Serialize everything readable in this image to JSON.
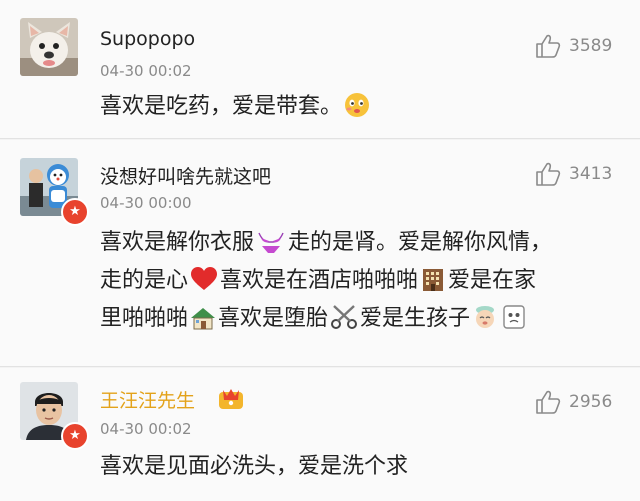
{
  "comments": [
    {
      "username": "Supopopo",
      "timestamp": "04-30 00:02",
      "likes": "3589",
      "text": "喜欢是吃药，爱是带套。",
      "avatar_icon": "bulldog-photo",
      "emoji": [
        "blushing-face-icon"
      ]
    },
    {
      "username": "没想好叫啥先就这吧",
      "timestamp": "04-30 00:00",
      "likes": "3413",
      "avatar_icon": "people-with-mascot-photo",
      "verified_badge": "verified-v-icon",
      "lines": [
        [
          "喜欢是解你衣服",
          "走的是肾。爱是解你风情，"
        ],
        [
          "走的是心",
          "喜欢是在酒店啪啪啪",
          "爱是在家"
        ],
        [
          "里啪啪啪",
          "喜欢是堕胎",
          "爱是生孩子"
        ]
      ],
      "emoji": [
        "bikini-icon",
        "red-heart-icon",
        "hotel-icon",
        "house-icon",
        "scissors-icon",
        "baby-face-icon",
        "ghost-face-icon"
      ]
    },
    {
      "username": "王汪汪先生",
      "timestamp": "04-30 00:02",
      "likes": "2956",
      "text": "喜欢是见面必洗头，爱是洗个求",
      "avatar_icon": "man-portrait-photo",
      "verified_badge": "verified-v-icon",
      "vip_badge": "vip-crown-icon"
    }
  ],
  "colors": {
    "background": "#f3f3f3",
    "card": "#fafafa",
    "gold_username": "#e3a21a",
    "verified_red": "#e8432d",
    "meta_gray": "#8a8a8a"
  }
}
